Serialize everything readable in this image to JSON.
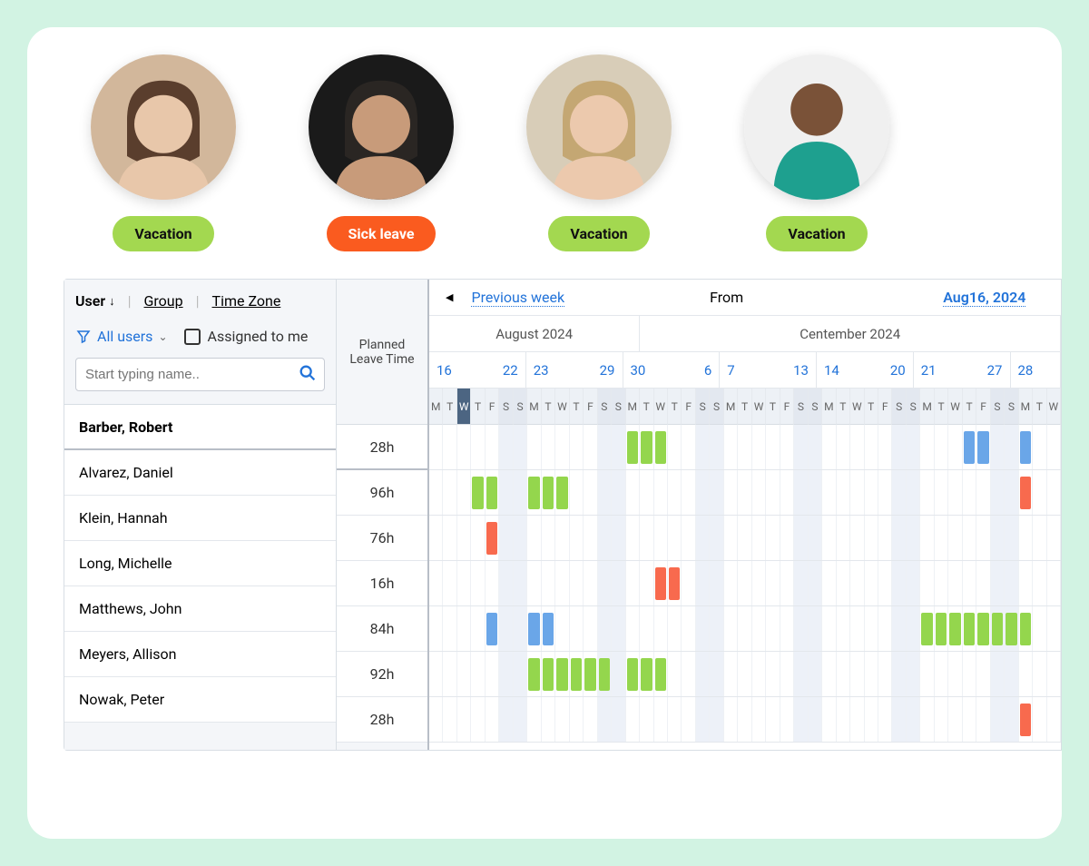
{
  "avatars": [
    {
      "status": "Vacation",
      "pill_class": "pill-green",
      "bg": "#d2b79b",
      "face": "#e8c7aa",
      "hair": "#5a3e2d"
    },
    {
      "status": "Sick leave",
      "pill_class": "pill-orange",
      "bg": "#1a1a1a",
      "face": "#c89b7a",
      "hair": "#2a2623"
    },
    {
      "status": "Vacation",
      "pill_class": "pill-green",
      "bg": "#d8cdb8",
      "face": "#ecc9ad",
      "hair": "#c4a773"
    },
    {
      "status": "Vacation",
      "pill_class": "pill-green",
      "bg": "#f0f0f0",
      "face": "#7a5238",
      "shirt": "#1ea08f"
    }
  ],
  "header": {
    "tab_user": "User",
    "tab_group": "Group",
    "tab_timezone": "Time Zone",
    "filter_all": "All users",
    "assigned": "Assigned to me",
    "search_placeholder": "Start typing name..",
    "planned": "Planned Leave Time"
  },
  "nav": {
    "prev": "Previous week",
    "from_label": "From",
    "from_date": "Aug16, 2024",
    "months": [
      {
        "label": "August 2024",
        "days": 15
      },
      {
        "label": "Centember 2024",
        "days": 30
      }
    ],
    "weeks": [
      {
        "start": "16",
        "end": "22"
      },
      {
        "start": "23",
        "end": "29"
      },
      {
        "start": "30",
        "end": "6"
      },
      {
        "start": "7",
        "end": "13"
      },
      {
        "start": "14",
        "end": "20"
      },
      {
        "start": "21",
        "end": "27"
      },
      {
        "start": "28",
        "end": ""
      }
    ],
    "day_letters": [
      "M",
      "T",
      "W",
      "T",
      "F",
      "S",
      "S"
    ],
    "today_global_index": 2,
    "last_week_days": 3
  },
  "users": [
    {
      "name": "Barber, Robert",
      "hours": "28h",
      "leave": [
        {
          "type": "green",
          "start": 14,
          "len": 3
        },
        {
          "type": "blue",
          "start": 38,
          "len": 2
        },
        {
          "type": "blue",
          "start": 42,
          "len": 1
        }
      ]
    },
    {
      "name": "Alvarez, Daniel",
      "hours": "96h",
      "leave": [
        {
          "type": "green",
          "start": 3,
          "len": 2
        },
        {
          "type": "green",
          "start": 7,
          "len": 3
        },
        {
          "type": "orange",
          "start": 42,
          "len": 1
        }
      ]
    },
    {
      "name": "Klein, Hannah",
      "hours": "76h",
      "leave": [
        {
          "type": "orange",
          "start": 4,
          "len": 1
        }
      ]
    },
    {
      "name": "Long, Michelle",
      "hours": "16h",
      "leave": [
        {
          "type": "orange",
          "start": 16,
          "len": 2
        }
      ]
    },
    {
      "name": "Matthews, John",
      "hours": "84h",
      "leave": [
        {
          "type": "blue",
          "start": 4,
          "len": 1
        },
        {
          "type": "blue",
          "start": 7,
          "len": 2
        },
        {
          "type": "green",
          "start": 35,
          "len": 8
        }
      ]
    },
    {
      "name": "Meyers, Allison",
      "hours": "92h",
      "leave": [
        {
          "type": "green",
          "start": 7,
          "len": 6
        },
        {
          "type": "green",
          "start": 14,
          "len": 3
        }
      ]
    },
    {
      "name": "Nowak, Peter",
      "hours": "28h",
      "leave": [
        {
          "type": "orange",
          "start": 42,
          "len": 1
        }
      ]
    }
  ],
  "colors": {
    "green": "#94d64d",
    "orange": "#f86a4e",
    "blue": "#6aa6e8"
  }
}
